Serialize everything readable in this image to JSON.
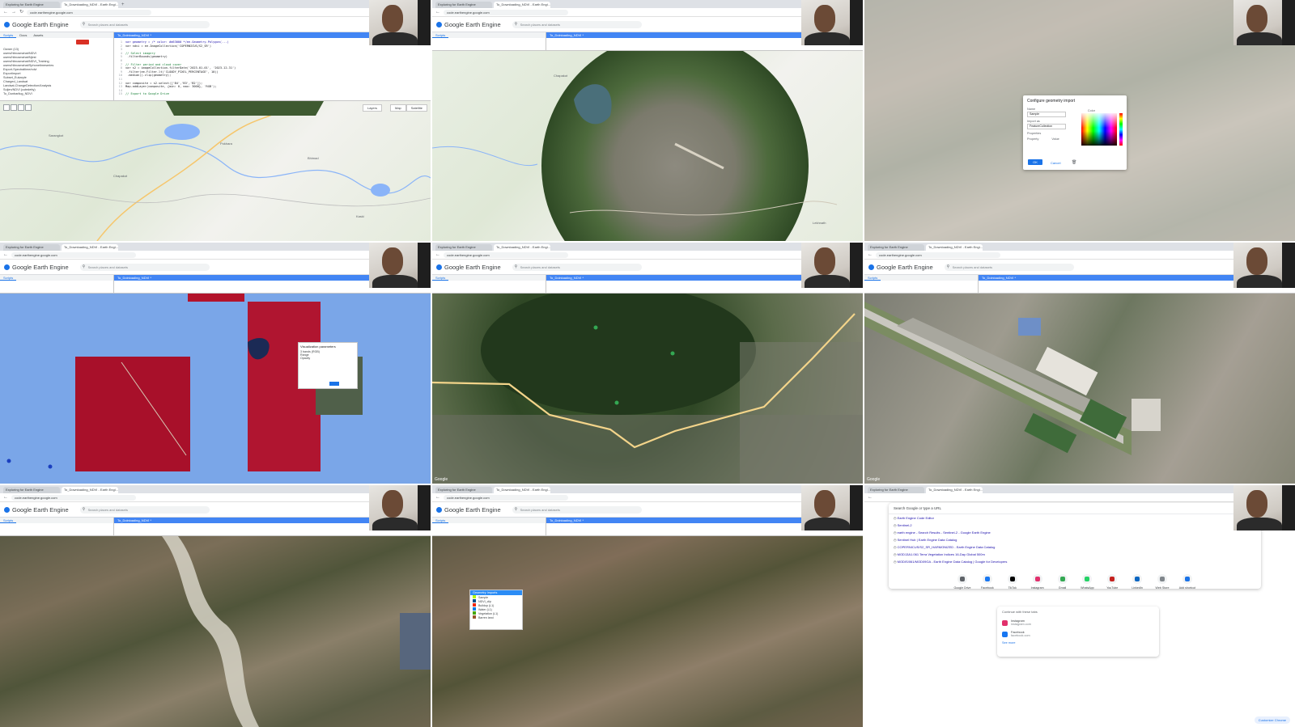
{
  "app": {
    "logo": "Google Earth Engine",
    "search_placeholder": "Search places and datasets",
    "url": "code.earthengine.google.com",
    "new_tab_symbol": "+",
    "tabs": [
      "Exploring for Earth Engine",
      "To_Downloading_NDVI - Earth Engi..."
    ]
  },
  "panels": {
    "left_tabs": [
      "Scripts",
      "Docs",
      "Assets"
    ],
    "tree": [
      "Owner (13)",
      "users/hlinusmahat/NDVI",
      "users/hlinusmahat/Njest",
      "users/hlinusmahat/NDVI_Training",
      "users/hlinusmahat/Sphonetimeseries",
      "Export-Spectraltime/ndvi",
      "Exportimport",
      "Subset_Eukaryle",
      "Charged_Landsat",
      "Landsat-ChangeDetection/Analysis",
      "Suljen/NDVI (cutedetty)",
      "To_Dunbarilug_NDVI"
    ],
    "editor_title": "To_Dolnioading_NDVI *",
    "code_lines": [
      {
        "n": "1",
        "t": "var geometry = /* color: #d63000 */ee.Geometry.Polygon(...)",
        "k": "kw"
      },
      {
        "n": "2",
        "t": "var ndvi = ee.ImageCollection('COPERNICUS/S2_SR')",
        "k": ""
      },
      {
        "n": "3",
        "t": "",
        "k": ""
      },
      {
        "n": "4",
        "t": "// Select imagery",
        "k": "cm"
      },
      {
        "n": "5",
        "t": "  .filterBounds(geometry)",
        "k": ""
      },
      {
        "n": "6",
        "t": "",
        "k": ""
      },
      {
        "n": "7",
        "t": "// Filter period and cloud cover",
        "k": "cm"
      },
      {
        "n": "8",
        "t": "var s2 = imageCollection.filterDate('2023-01-01', '2023-12-31')",
        "k": ""
      },
      {
        "n": "9",
        "t": "  .filter(ee.Filter.lt('CLOUDY_PIXEL_PERCENTAGE', 10))",
        "k": ""
      },
      {
        "n": "10",
        "t": "  .median().clip(geometry);",
        "k": ""
      },
      {
        "n": "11",
        "t": "",
        "k": ""
      },
      {
        "n": "12",
        "t": "var composite = s2.select(['B4','B3','B2']);",
        "k": ""
      },
      {
        "n": "13",
        "t": "Map.addLayer(composite, {min: 0, max: 3000}, 'RGB');",
        "k": ""
      },
      {
        "n": "14",
        "t": "",
        "k": ""
      },
      {
        "n": "15",
        "t": "// Export to Google Drive",
        "k": "cm"
      }
    ]
  },
  "map_ui": {
    "map_button": "Map",
    "satellite_button": "Satellite",
    "layers_button": "Layers",
    "zoom_in": "+",
    "zoom_out": "−",
    "attribution": "Google"
  },
  "tile1_labels": [
    "Pokhara",
    "Chapakot",
    "Bhimad",
    "Sarangkot",
    "Kaski"
  ],
  "tile2_labels": [
    "Chapakot",
    "Lekhnath"
  ],
  "dialog": {
    "title": "Configure geometry import",
    "name_label": "Name",
    "name_value": "Sample",
    "import_as_label": "Import as",
    "import_as_value": "FeatureCollection",
    "properties_label": "Properties",
    "property_col": "Property",
    "value_col": "Value",
    "color_label": "Color",
    "color_value": "#98ff00",
    "ok": "OK",
    "cancel": "Cancel"
  },
  "inspector": {
    "title": "Visualization parameters",
    "bands": "3 bands (RGB)",
    "range": "Range",
    "opacity": "Opacity",
    "apply": "Apply"
  },
  "legend": {
    "title": "Geometry Imports",
    "items": [
      "Sample",
      "NDVI_clip",
      "Buildup (L1)",
      "Water (L1)",
      "Vegetation (L1)",
      "Barren land"
    ],
    "colors": [
      "#98ff00",
      "#0b4a8b",
      "#d63000",
      "#1a73e8",
      "#38a800",
      "#8b5a2b"
    ]
  },
  "search": {
    "query": "Search Google or type a URL",
    "results": [
      "Earth Engine Code Editor",
      "Sentinel-2",
      "earth engine - Search Results - Sentinel-2 - Google Earth Engine",
      "Sentinel Hub | Earth Engine Data Catalog",
      "COPERNICUS/S2_SR_HARMONIZED - Earth Engine Data Catalog",
      "MOD13A1.061 Terra Vegetation Indices 16-Day Global 500m",
      "MODIS/061/MOD09GA - Earth Engine Data Catalog | Google for Developers"
    ],
    "shortcuts": [
      {
        "label": "Google Drive",
        "color": "#5f6368"
      },
      {
        "label": "Facebook",
        "color": "#1877f2"
      },
      {
        "label": "TikTok",
        "color": "#000000"
      },
      {
        "label": "Instagram",
        "color": "#e1306c"
      },
      {
        "label": "Gmail",
        "color": "#34a853"
      },
      {
        "label": "WhatsApp",
        "color": "#25d366"
      },
      {
        "label": "YouTube",
        "color": "#c5221f"
      },
      {
        "label": "LinkedIn",
        "color": "#0a66c2"
      },
      {
        "label": "Web Store",
        "color": "#80868b"
      },
      {
        "label": "Add shortcut",
        "color": "#1a73e8"
      }
    ],
    "card_title": "Continue with these tabs",
    "card_items": [
      {
        "title": "Instagram",
        "sub": "instagram.com",
        "color": "#e1306c"
      },
      {
        "title": "Facebook",
        "sub": "facebook.com",
        "color": "#1877f2"
      }
    ],
    "card_more": "See more",
    "customize": "Customize Chrome"
  }
}
